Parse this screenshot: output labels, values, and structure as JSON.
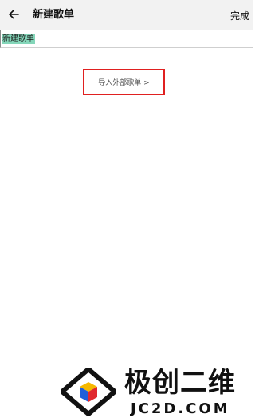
{
  "header": {
    "title": "新建歌单",
    "done_label": "完成",
    "back_icon": "arrow-left-icon"
  },
  "playlist_name": {
    "value": "新建歌单"
  },
  "import": {
    "label": "导入外部歌单 >"
  },
  "watermark": {
    "brand_cn": "极创二维",
    "brand_en": "JC2D.COM"
  },
  "colors": {
    "header_bg": "#f2f2f2",
    "selection": "#84d6b9",
    "highlight_box": "#e02020"
  }
}
